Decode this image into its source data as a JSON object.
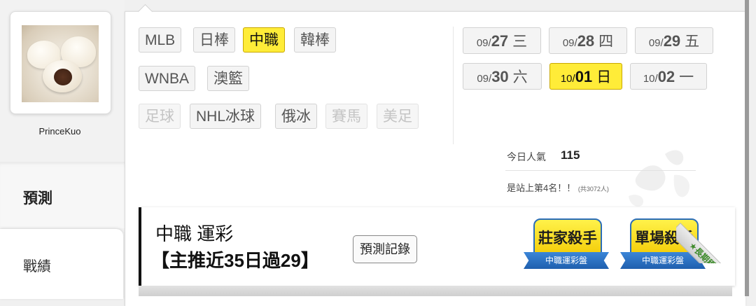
{
  "profile": {
    "username": "PrinceKuo"
  },
  "nav": {
    "predict_label": "預測",
    "record_label": "戰績"
  },
  "sports": [
    {
      "label": "MLB",
      "state": "normal"
    },
    {
      "label": "日棒",
      "state": "normal"
    },
    {
      "label": "中職",
      "state": "active"
    },
    {
      "label": "韓棒",
      "state": "normal"
    },
    {
      "label": "WNBA",
      "state": "normal"
    },
    {
      "label": "澳籃",
      "state": "normal"
    },
    {
      "label": "足球",
      "state": "disabled"
    },
    {
      "label": "NHL冰球",
      "state": "normal"
    },
    {
      "label": "俄冰",
      "state": "normal"
    },
    {
      "label": "賽馬",
      "state": "disabled"
    },
    {
      "label": "美足",
      "state": "disabled"
    }
  ],
  "dates": [
    {
      "md": "09/",
      "day": "27",
      "weekday": "三",
      "active": false
    },
    {
      "md": "09/",
      "day": "28",
      "weekday": "四",
      "active": false
    },
    {
      "md": "09/",
      "day": "29",
      "weekday": "五",
      "active": false
    },
    {
      "md": "09/",
      "day": "30",
      "weekday": "六",
      "active": false
    },
    {
      "md": "10/",
      "day": "01",
      "weekday": "日",
      "active": true
    },
    {
      "md": "10/",
      "day": "02",
      "weekday": "一",
      "active": false
    }
  ],
  "stats": {
    "popularity_label": "今日人氣",
    "popularity_value": "115",
    "rank_text": "是站上第4名！！",
    "rank_sub": "(共3072人)"
  },
  "card": {
    "title": "中職 運彩",
    "subtitle": "【主推近35日過29】",
    "record_button": "預測記錄",
    "badges": [
      {
        "title": "莊家殺手",
        "ribbon": "中職運彩盤"
      },
      {
        "title": "單場殺手",
        "ribbon": "中職運彩盤"
      }
    ],
    "corner_label": "★長期穩定"
  }
}
